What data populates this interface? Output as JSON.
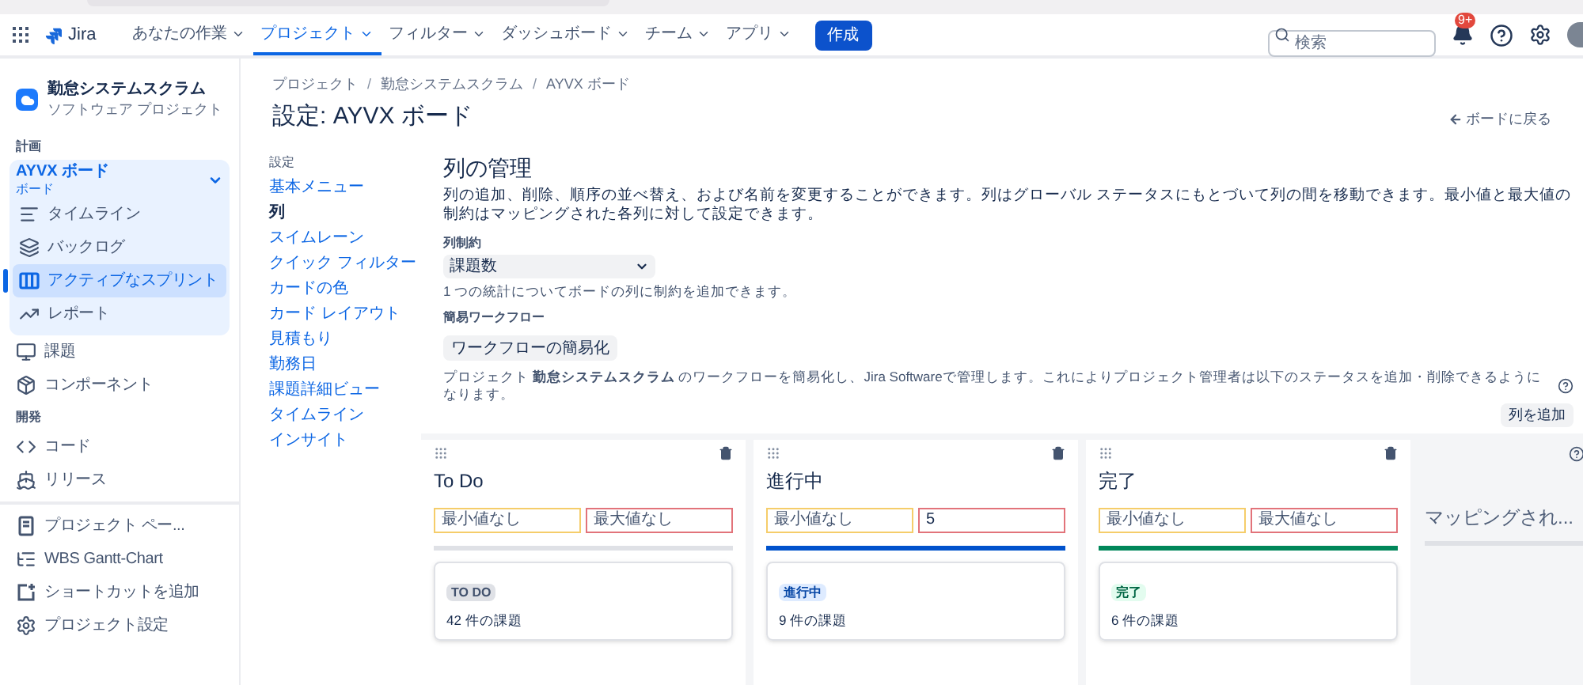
{
  "nav": {
    "product": "Jira",
    "items": [
      {
        "label": "あなたの作業",
        "selected": false
      },
      {
        "label": "プロジェクト",
        "selected": true
      },
      {
        "label": "フィルター",
        "selected": false
      },
      {
        "label": "ダッシュボード",
        "selected": false
      },
      {
        "label": "チーム",
        "selected": false
      },
      {
        "label": "アプリ",
        "selected": false
      }
    ],
    "create": "作成",
    "search_placeholder": "検索",
    "notification_badge": "9+"
  },
  "sidebar": {
    "project": {
      "name": "勤怠システムスクラム",
      "type": "ソフトウェア プロジェクト"
    },
    "sections": [
      {
        "title": "計画",
        "board": {
          "name": "AYVX ボード",
          "type": "ボード",
          "expanded": true
        },
        "items": [
          {
            "label": "タイムライン",
            "kind": "timeline",
            "selected": false
          },
          {
            "label": "バックログ",
            "kind": "backlog",
            "selected": false
          },
          {
            "label": "アクティブなスプリント",
            "kind": "sprint",
            "selected": true
          },
          {
            "label": "レポート",
            "kind": "report",
            "selected": false
          }
        ]
      },
      {
        "items": [
          {
            "label": "課題",
            "kind": "issues",
            "selected": false
          },
          {
            "label": "コンポーネント",
            "kind": "components",
            "selected": false
          }
        ]
      },
      {
        "title": "開発",
        "items": [
          {
            "label": "コード",
            "kind": "code",
            "selected": false
          },
          {
            "label": "リリース",
            "kind": "releases",
            "selected": false
          }
        ]
      },
      {
        "items": [
          {
            "label": "プロジェクト ペー...",
            "kind": "page",
            "selected": false
          },
          {
            "label": "WBS Gantt-Chart",
            "kind": "gantt",
            "selected": false
          },
          {
            "label": "ショートカットを追加",
            "kind": "shortcut",
            "selected": false
          },
          {
            "label": "プロジェクト設定",
            "kind": "settings",
            "selected": false
          }
        ]
      }
    ]
  },
  "breadcrumbs": [
    "プロジェクト",
    "勤怠システムスクラム",
    "AYVX ボード"
  ],
  "breadcrumb_separator": "/",
  "title": "設定: AYVX ボード",
  "back_link": "ボードに戻る",
  "settings_nav": {
    "heading": "設定",
    "items": [
      {
        "label": "基本メニュー",
        "selected": false
      },
      {
        "label": "列",
        "selected": true
      },
      {
        "label": "スイムレーン",
        "selected": false
      },
      {
        "label": "クイック フィルター",
        "selected": false
      },
      {
        "label": "カードの色",
        "selected": false
      },
      {
        "label": "カード レイアウト",
        "selected": false
      },
      {
        "label": "見積もり",
        "selected": false
      },
      {
        "label": "勤務日",
        "selected": false
      },
      {
        "label": "課題詳細ビュー",
        "selected": false
      },
      {
        "label": "タイムライン",
        "selected": false
      },
      {
        "label": "インサイト",
        "selected": false
      }
    ]
  },
  "section": {
    "title": "列の管理",
    "description": "列の追加、削除、順序の並べ替え、および名前を変更することができます。列はグローバル ステータスにもとづいて列の間を移動できます。最小値と最大値の制約はマッピングされた各列に対して設定できます。",
    "constraint_label": "列制約",
    "constraint_value": "課題数",
    "constraint_hint": "1 つの統計についてボードの列に制約を追加できます。",
    "workflow_label": "簡易ワークフロー",
    "workflow_button": "ワークフローの簡易化",
    "workflow_note": "プロジェクト **勤怠システムスクラム** のワークフローを簡易化し、Jira Softwareで管理します。これによりプロジェクト管理者は以下のステータスを追加・削除できるようになります。",
    "add_column": "列を追加"
  },
  "columns": [
    {
      "name": "To Do",
      "kind": "todo",
      "min": {
        "placeholder": "最小値なし"
      },
      "max": {
        "placeholder": "最大値なし"
      },
      "status": "TO DO",
      "count": "42 件の課題"
    },
    {
      "name": "進行中",
      "kind": "inprogress",
      "min": {
        "placeholder": "最小値なし"
      },
      "max": {
        "value": "5"
      },
      "status": "進行中",
      "count": "9 件の課題"
    },
    {
      "name": "完了",
      "kind": "done",
      "min": {
        "placeholder": "最小値なし"
      },
      "max": {
        "placeholder": "最大値なし"
      },
      "status": "完了",
      "count": "6 件の課題"
    }
  ],
  "unmapped": {
    "title": "マッピングされ..."
  }
}
